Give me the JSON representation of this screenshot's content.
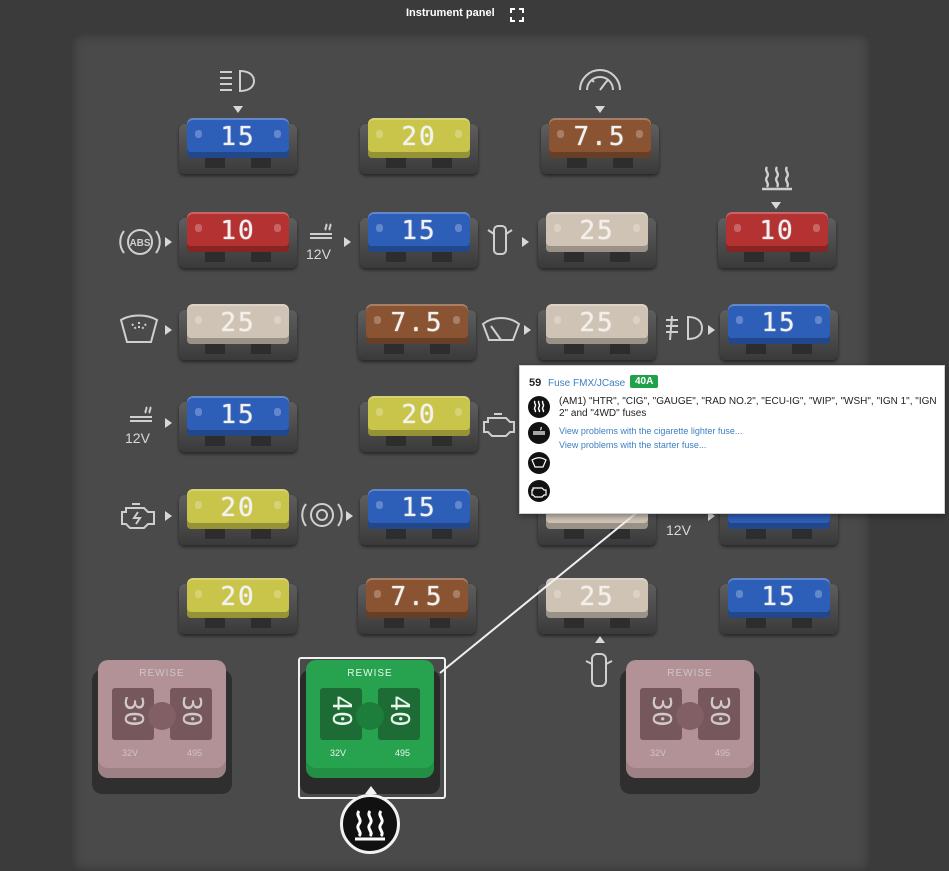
{
  "header": {
    "title": "Instrument panel"
  },
  "fuses": {
    "r1c1": "15",
    "r1c2": "20",
    "r1c3": "7.5",
    "r2c1": "10",
    "r2c2": "15",
    "r2c3": "25",
    "r2c4": "10",
    "r3c1": "25",
    "r3c2": "7.5",
    "r3c3": "25",
    "r3c4": "15",
    "r4c1": "15",
    "r4c2": "20",
    "r5c1": "20",
    "r5c2": "15",
    "r6c1": "20",
    "r6c2": "7.5",
    "r6c3": "25",
    "r6c4": "15"
  },
  "labels": {
    "v12": "12V"
  },
  "maxi_fuses": {
    "brand": "REWISE",
    "left": {
      "rating": "30",
      "voltage": "32V",
      "code": "495"
    },
    "selected": {
      "rating": "40",
      "voltage": "32V",
      "code": "495"
    },
    "right": {
      "rating": "30",
      "voltage": "32V",
      "code": "495"
    }
  },
  "popup": {
    "number": "59",
    "type": "Fuse FMX/JCase",
    "amperage": "40A",
    "description": "(AM1) \"HTR\", \"CIG\", \"GAUGE\", \"RAD NO.2\", \"ECU-IG\", \"WIP\", \"WSH\", \"IGN 1\", \"IGN 2\" and \"4WD\" fuses",
    "link1": "View problems with the cigarette lighter fuse...",
    "link2": "View problems with the starter fuse...",
    "icons": [
      "heater-icon",
      "cigarette-lighter-icon",
      "wiper-icon",
      "engine-icon"
    ]
  },
  "colors": {
    "blue": "#2e5fb8",
    "yellow": "#c9c44a",
    "brown": "#8a5433",
    "red": "#b43232",
    "beige": "#cfc3b5",
    "maxi_pink": "#c9a2a7",
    "maxi_green": "#27a34f",
    "badge_green": "#1fa24a"
  }
}
